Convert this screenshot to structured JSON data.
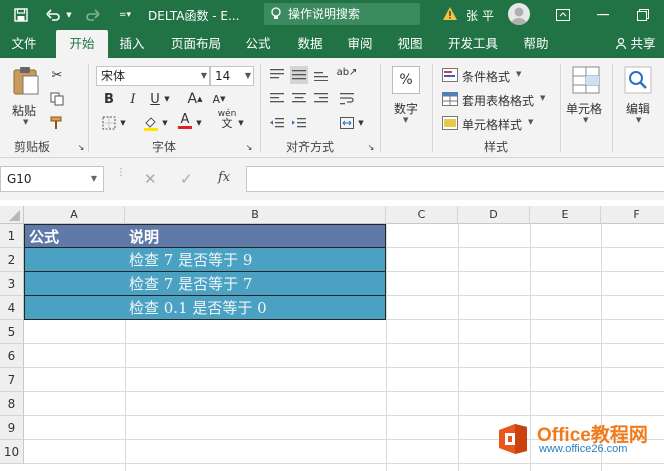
{
  "titlebar": {
    "title": "DELTA函数 - E...",
    "search_placeholder": "操作说明搜索",
    "user": "张平"
  },
  "tabs": [
    {
      "label": "文件"
    },
    {
      "label": "开始"
    },
    {
      "label": "插入"
    },
    {
      "label": "页面布局"
    },
    {
      "label": "公式"
    },
    {
      "label": "数据"
    },
    {
      "label": "审阅"
    },
    {
      "label": "视图"
    },
    {
      "label": "开发工具"
    },
    {
      "label": "帮助"
    },
    {
      "label": "共享"
    }
  ],
  "ribbon": {
    "clipboard": {
      "paste": "粘贴",
      "label": "剪贴板"
    },
    "font": {
      "name": "宋体",
      "size": "14",
      "label": "字体",
      "bold": "B",
      "italic": "I",
      "underline": "U",
      "grow": "A",
      "shrink": "A",
      "color_a": "A",
      "wen": "wén"
    },
    "align": {
      "label": "对齐方式"
    },
    "number": {
      "label": "数字",
      "symbol": "%"
    },
    "styles": {
      "cond": "条件格式",
      "table": "套用表格格式",
      "cell": "单元格样式",
      "label": "样式"
    },
    "cells": {
      "label": "单元格"
    },
    "edit": {
      "label": "编辑"
    }
  },
  "formula_bar": {
    "name_box": "G10",
    "fx": "fx",
    "value": ""
  },
  "grid": {
    "columns": [
      "A",
      "B",
      "C",
      "D",
      "E",
      "F"
    ],
    "rows": [
      "1",
      "2",
      "3",
      "4",
      "5",
      "6",
      "7",
      "8",
      "9",
      "10"
    ],
    "header": {
      "a": "公式",
      "b": "说明"
    },
    "data": [
      {
        "a": "",
        "b": "检查 7 是否等于 9"
      },
      {
        "a": "",
        "b": "检查 7 是否等于 7"
      },
      {
        "a": "",
        "b": "检查 0.1 是否等于 0"
      }
    ]
  },
  "watermark": {
    "brand": "Office教程网",
    "url": "www.office26.com"
  },
  "colors": {
    "excel_green": "#217346",
    "header_fill": "#5f79a8",
    "data_fill": "#4aa1c2",
    "brand_orange": "#f07b1d"
  }
}
